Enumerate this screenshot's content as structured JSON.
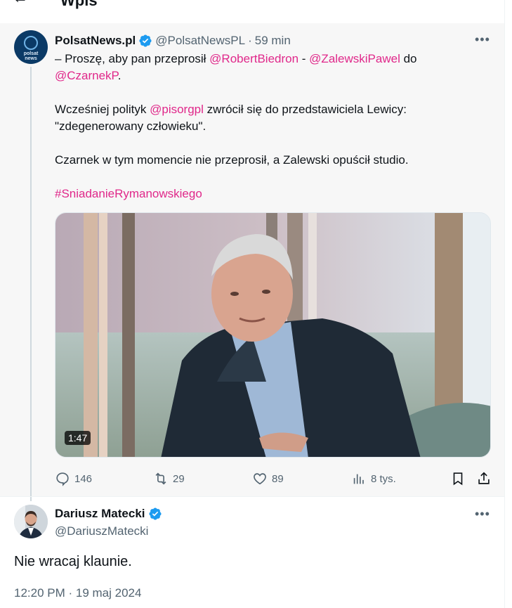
{
  "header": {
    "back_icon": "arrow-left-icon",
    "title": "Wpis"
  },
  "tweet": {
    "display_name": "PolsatNews.pl",
    "handle": "@PolsatNewsPL",
    "separator": "·",
    "time": "59 min",
    "avatar_text_line1": "polsat",
    "avatar_text_line2": "news",
    "paragraph1": {
      "pre": "– Proszę, aby pan przeprosił ",
      "mention1": "@RobertBiedron",
      "mid1": " - ",
      "mention2": "@ZalewskiPawel",
      "mid2": " do",
      "mention3": "@CzarnekP",
      "post": "."
    },
    "paragraph2": {
      "pre": "Wcześniej polityk ",
      "mention": "@pisorgpl",
      "post_line1": " zwrócił się do przedstawiciela Lewicy:",
      "line2": "\"zdegenerowany człowieku\"."
    },
    "paragraph3": "Czarnek w tym momencie nie przeprosił, a Zalewski opuścił studio.",
    "hashtag": "#SniadanieRymanowskiego",
    "video_duration": "1:47",
    "actions": {
      "replies": "146",
      "retweets": "29",
      "likes": "89",
      "views": "8 tys."
    }
  },
  "reply": {
    "display_name": "Dariusz Matecki",
    "handle": "@DariuszMatecki",
    "text": "Nie wracaj klaunie.",
    "timestamp": "12:20 PM · 19 maj 2024"
  },
  "colors": {
    "link": "#e0288a",
    "verified": "#1d9bf0",
    "muted": "#536471",
    "text": "#0f1419"
  }
}
